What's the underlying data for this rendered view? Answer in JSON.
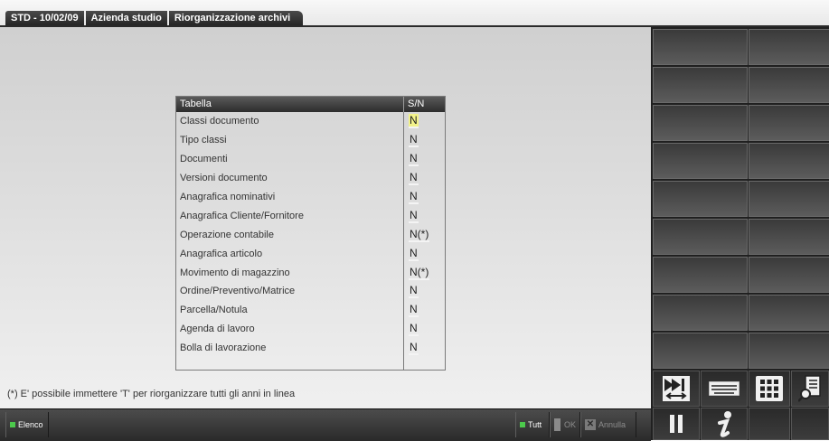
{
  "window": {
    "tabs": [
      "STD - 10/02/09",
      "Azienda studio",
      "Riorganizzazione archivi"
    ]
  },
  "table": {
    "headers": [
      "Tabella",
      "S/N"
    ],
    "rows": [
      {
        "label": "Classi documento",
        "value": "N"
      },
      {
        "label": "Tipo classi",
        "value": "N"
      },
      {
        "label": "Documenti",
        "value": "N"
      },
      {
        "label": "Versioni documento",
        "value": "N"
      },
      {
        "label": "Anagrafica nominativi",
        "value": "N"
      },
      {
        "label": "Anagrafica Cliente/Fornitore",
        "value": "N"
      },
      {
        "label": "Operazione contabile",
        "value": "N(*)"
      },
      {
        "label": "Anagrafica articolo",
        "value": "N"
      },
      {
        "label": "Movimento di magazzino",
        "value": "N(*)"
      },
      {
        "label": "Ordine/Preventivo/Matrice",
        "value": "N"
      },
      {
        "label": "Parcella/Notula",
        "value": "N"
      },
      {
        "label": "Agenda di lavoro",
        "value": "N"
      },
      {
        "label": "Bolla di lavorazione",
        "value": "N"
      }
    ]
  },
  "footnote": "(*) E' possibile immettere 'T' per riorganizzare tutti gli anni in linea",
  "bottombar": {
    "elenco": "Elenco",
    "tutti": "Tutt",
    "ok": "OK",
    "annulla": "Annulla"
  },
  "colors": {
    "active_field": "#f2f28a",
    "header_dark": "#2c2c2c",
    "status_green": "#4cc94c"
  },
  "icons": [
    "fast-forward-swap-icon",
    "keyboard-icon",
    "grid-menu-icon",
    "document-search-icon",
    "pause-icon",
    "info-icon"
  ]
}
